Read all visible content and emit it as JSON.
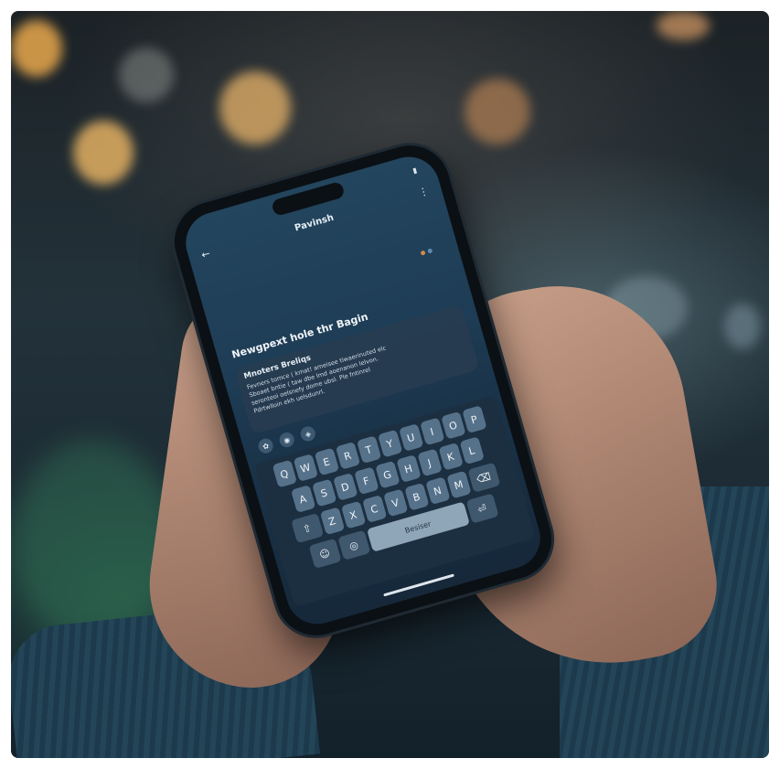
{
  "phone": {
    "status_left": "",
    "status_time": "",
    "nav_title": "Pavinsh",
    "back_icon": "arrow-left-icon",
    "menu_icon": "more-icon",
    "heading": "Newgpext hole thr Bagin",
    "bubble_title": "Mnoters Breliqs",
    "bubble_lines": [
      "Fevners tomce ( kmat! ameisee tiwaerinuted elc",
      "Sboaet bntie ( taw dbe lmd aoenanon lelvon.",
      "seronteoi oelsnefy dome ubsl. Ple fntinrel",
      "Pdrtwlloin ekh uelsdunrl."
    ],
    "chips": [
      "✿",
      "◉",
      "◈"
    ],
    "keyboard": {
      "row1": [
        "Q",
        "W",
        "E",
        "R",
        "T",
        "Y",
        "U",
        "I",
        "O",
        "P"
      ],
      "row2": [
        "A",
        "S",
        "D",
        "F",
        "G",
        "H",
        "J",
        "K",
        "L"
      ],
      "row3": [
        "Z",
        "X",
        "C",
        "V",
        "B",
        "N",
        "M"
      ],
      "shift_icon": "shift-icon",
      "delete_icon": "backspace-icon",
      "emoji_icon": "emoji-icon",
      "globe_icon": "globe-icon",
      "space_label": "Besiser",
      "return_label": "⏎"
    }
  }
}
